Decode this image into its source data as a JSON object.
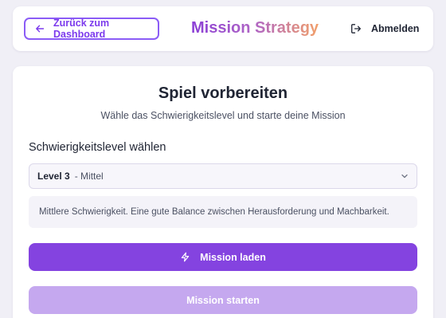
{
  "header": {
    "back_label": "Zurück zum Dashboard",
    "back_icon": "arrow-left-icon",
    "app_title": "Mission Strategy",
    "logout_label": "Abmelden",
    "logout_icon": "logout-icon"
  },
  "main": {
    "title": "Spiel vorbereiten",
    "subtitle": "Wähle das Schwierigkeitslevel und starte deine Mission",
    "difficulty_label": "Schwierigkeitslevel wählen",
    "select": {
      "level": "Level 3",
      "level_desc": "- Mittel",
      "chevron_icon": "chevron-down-icon"
    },
    "level_description": "Mittlere Schwierigkeit. Eine gute Balance zwischen Herausforderung und Machbarkeit.",
    "load_button": {
      "label": "Mission laden",
      "icon": "bolt-icon"
    },
    "start_button": {
      "label": "Mission starten"
    }
  },
  "colors": {
    "accent": "#8443e0",
    "accent_disabled": "#c5a8ef",
    "back_border": "#8b5cf6",
    "title_gradient_start": "#8b3fd6",
    "title_gradient_end": "#f2a06a",
    "page_background": "#f0eff6"
  }
}
